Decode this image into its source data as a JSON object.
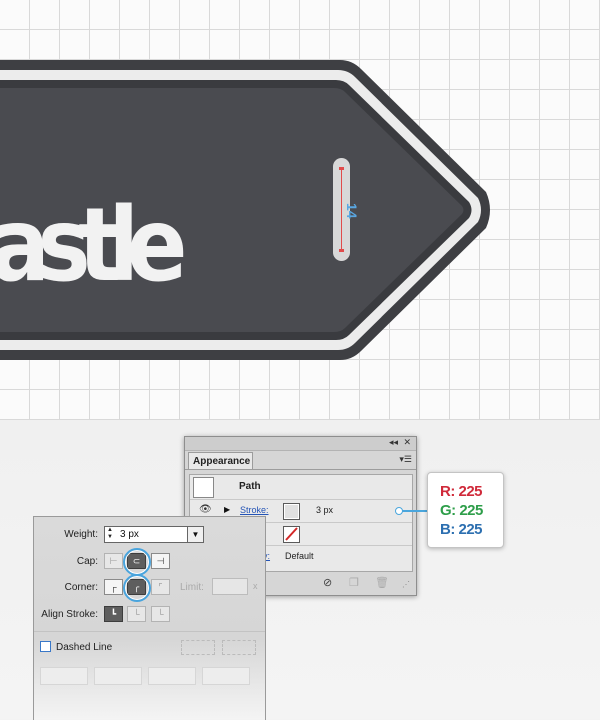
{
  "artwork": {
    "label_text": "astle",
    "measurement": "14",
    "colors": {
      "outer": "#3e3f43",
      "band": "#ececec",
      "inner": "#4a4b50",
      "text": "#f2f2f2"
    }
  },
  "appearance_panel": {
    "tab_label": "Appearance",
    "row_path_label": "Path",
    "stroke_link": "Stroke:",
    "stroke_value": "3 px",
    "opacity_link": "y:",
    "opacity_value": "Default"
  },
  "color_callout": {
    "r": "R: 225",
    "g": "G: 225",
    "b": "B: 225",
    "colors": {
      "r": "#d02a3a",
      "g": "#2e9e4a",
      "b": "#2c6fb0"
    }
  },
  "stroke_panel": {
    "weight_label": "Weight:",
    "weight_value": "3 px",
    "cap_label": "Cap:",
    "corner_label": "Corner:",
    "limit_label": "Limit:",
    "limit_suffix": "x",
    "align_label": "Align Stroke:",
    "dashed_label": "Dashed Line"
  }
}
